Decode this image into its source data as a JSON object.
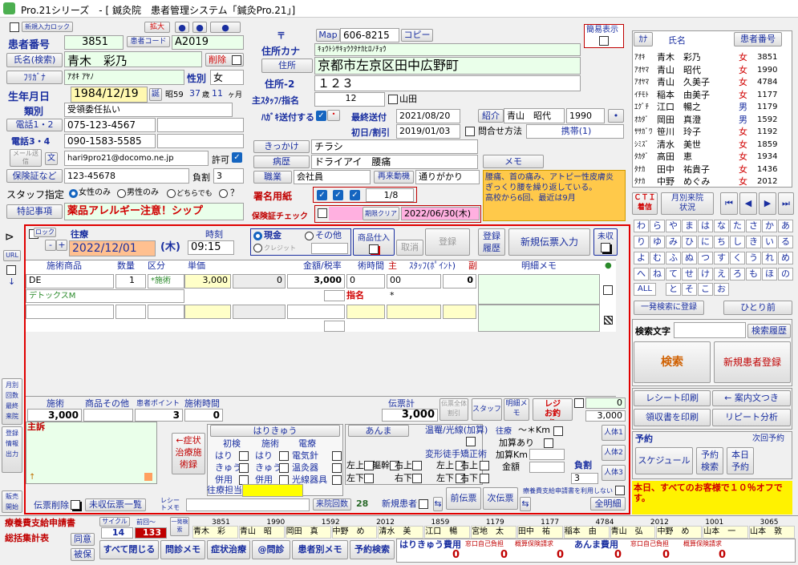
{
  "window": {
    "title": "Pro.21シリーズ　- [ 鍼灸院　患者管理システム「鍼灸Pro.21」]"
  },
  "patient": {
    "input_lock": "新規入力ロック",
    "zoom": "拡大",
    "patient_no_label": "患者番号",
    "patient_no": "3851",
    "patient_code_label": "患者コード",
    "patient_code": "A2019",
    "name_search": "氏名(検索)",
    "name": "青木　彩乃",
    "delete": "削除",
    "furigana_label": "ﾌﾘｶﾞﾅ",
    "furigana": "ｱｵｷ ｱﾔﾉ",
    "sex_label": "性別",
    "sex": "女",
    "birth_label": "生年月日",
    "birth": "1984/12/19",
    "birth_tan": "誕",
    "wareki": "昭59",
    "age": "37",
    "age_unit": "歳",
    "months": "11",
    "month_unit": "ヶ月",
    "category_label": "類別",
    "category": "受領委任払い",
    "tel12": "電話1・2",
    "tel1": "075-123-4567",
    "tel34": "電話3・4",
    "tel3": "090-1583-5585",
    "mail_send": "メール送信",
    "mail_char": "文",
    "email": "hari9pro21@docomo.ne.jp",
    "allow": "許可",
    "insurance_label": "保険証など",
    "insurance": "123-45678",
    "burden_label": "負割",
    "burden": "3",
    "staff_label": "スタッフ指定",
    "staff_opt1": "女性のみ",
    "staff_opt2": "男性のみ",
    "staff_opt3": "どちらでも",
    "staff_q": "？",
    "notes_label": "特記事項",
    "notes": "薬品アレルギー注意！シップ"
  },
  "address": {
    "zip_mark": "〒",
    "map": "Map",
    "zip": "606-8215",
    "copy": "コピー",
    "kana_label": "住所カナ",
    "kana": "ｷｮｳﾄｼｻｷｮｳｸﾀﾅｶﾋﾛﾉﾁｮｳ",
    "addr_btn": "住所",
    "addr": "京都市左京区田中広野町",
    "addr2_label": "住所-2",
    "addr2": "１２３",
    "main_staff_label": "主ｽﾀｯﾌ/指名",
    "main_staff": "12",
    "yamada": "山田",
    "postcard_label": "ﾊｶﾞｷ送付する",
    "last_sent_label": "最終送付",
    "last_sent": "2021/08/20",
    "intro_label": "紹介",
    "intro_name": "青山　昭代",
    "intro_no": "1990",
    "intro_dot": "•",
    "first_visit_label": "初日/割引",
    "first_visit": "2019/01/03",
    "inquiry_label": "問合せ方法",
    "inquiry": "携帯(1)",
    "trigger_btn": "きっかけ",
    "trigger": "チラシ",
    "disease_btn": "病歴",
    "disease": "ドライアイ　腰痛",
    "memo_btn": "メモ",
    "job_btn": "職業",
    "job": "会社員",
    "revisit_btn": "再来動機",
    "revisit": "通りがかり",
    "memo_text": "腰痛、首の痛み、アトピー性皮膚炎\nぎっくり腰を繰り返している。\n高校から6回、最近は9月",
    "sign_label": "署名用紙",
    "sign_count": "1/8",
    "ins_check_label": "保険証チェック",
    "expiry_label": "期限クリア",
    "expiry": "2022/06/30(木)",
    "simple_view": "簡易表示"
  },
  "patient_list": {
    "col_kana": "ｶﾅ",
    "col_name": "氏名",
    "col_no": "患者番号",
    "rows": [
      {
        "kana": "ｱｵｷ",
        "name": "青木　彩乃",
        "sex": "女",
        "no": "3851"
      },
      {
        "kana": "ｱｵﾔﾏ",
        "name": "青山　昭代",
        "sex": "女",
        "no": "1990"
      },
      {
        "kana": "ｱｵﾔﾏ",
        "name": "青山　久美子",
        "sex": "女",
        "no": "4784"
      },
      {
        "kana": "ｲﾁﾓﾄ",
        "name": "稲本　由美子",
        "sex": "女",
        "no": "1177"
      },
      {
        "kana": "ｴｸﾞﾁ",
        "name": "江口　暢之",
        "sex": "男",
        "no": "1179"
      },
      {
        "kana": "ｵｶﾀﾞ",
        "name": "岡田　真澄",
        "sex": "男",
        "no": "1592"
      },
      {
        "kana": "ｻｻｶﾞﾜ",
        "name": "笹川　玲子",
        "sex": "女",
        "no": "1192"
      },
      {
        "kana": "ｼﾐｽﾞ",
        "name": "清水　美世",
        "sex": "女",
        "no": "1859"
      },
      {
        "kana": "ﾀｶﾀﾞ",
        "name": "高田　恵",
        "sex": "女",
        "no": "1934"
      },
      {
        "kana": "ﾀﾅｶ",
        "name": "田中　祐貴子",
        "sex": "女",
        "no": "1436"
      },
      {
        "kana": "ﾀﾅｶ",
        "name": "中野　めぐみ",
        "sex": "女",
        "no": "2012"
      }
    ],
    "cti": "ＣＴＩ着信",
    "monthly": "月別来院状況",
    "kana_keys": [
      "わ",
      "ら",
      "や",
      "ま",
      "は",
      "な",
      "た",
      "さ",
      "か",
      "あ",
      "り",
      "ゆ",
      "み",
      "ひ",
      "に",
      "ち",
      "し",
      "き",
      "い",
      "る",
      "よ",
      "む",
      "ふ",
      "ぬ",
      "つ",
      "す",
      "く",
      "う",
      "れ",
      "め",
      "へ",
      "ね",
      "て",
      "せ",
      "け",
      "え",
      "ろ",
      "も",
      "ほ",
      "の",
      "と",
      "そ",
      "こ",
      "お"
    ],
    "all_key": "ALL",
    "one_search": "一発検索に登録",
    "hitori": "ひとり前",
    "search_label": "検索文字",
    "search_history": "検索履歴",
    "search": "検索",
    "new_patient": "新規患者登録",
    "receipt_print": "レシート印刷",
    "guide": "← 案内文つき",
    "receipt_issue": "領収書を印刷",
    "repeat": "リピート分析",
    "reserve_label": "予約",
    "next_reserve": "次回予約",
    "schedule": "スケジュール",
    "reserve_search": "予約検索",
    "today_reserve": "本日予約",
    "notice": "本日、すべてのお客様で１０％オフです。"
  },
  "slip": {
    "lock": "ロック",
    "visit_label": "往療",
    "visit_date": "2022/12/01",
    "weekday": "(木)",
    "time_label": "時刻",
    "time": "09:15",
    "cash": "現金",
    "other": "その他",
    "credit": "クレジット",
    "stock": "商品仕入",
    "cancel": "取消",
    "register": "登録",
    "reg_history": "登録履歴",
    "new_slip": "新規伝票入力",
    "unpaid": "未収",
    "headers": [
      "施術商品",
      "数量",
      "区分",
      "単価",
      "金額/税率",
      "術時間",
      "主",
      "ｽﾀｯﾌ(ﾎﾟｲﾝﾄ)",
      "副",
      "明細メモ"
    ],
    "row1": {
      "item": "DE",
      "qty": "1",
      "kind": "*施術",
      "price": "3,000",
      "tax": "0",
      "amount": "3,000",
      "time": "0",
      "staff": "00",
      "sub": "0"
    },
    "row1b": {
      "item": "デトックスM",
      "shimei": "指名",
      "star": "*"
    },
    "sum_labels": {
      "treat": "施術",
      "goods": "商品その他",
      "points": "患者ポイント",
      "treat_time": "施術時間",
      "total": "伝票計",
      "discount": "伝票全体割引",
      "staff": "スタッフ",
      "detail_memo": "明細メモ",
      "register_change": "レジお釣り"
    },
    "sum_values": {
      "treat": "3,000",
      "goods": "",
      "points": "3",
      "treat_time": "0",
      "total": "3,000",
      "cash_in": "0",
      "change": "3,000"
    },
    "chief": "主訴",
    "side": [
      "月別",
      "回数",
      "最終",
      "来院",
      "登録",
      "情報",
      "出力",
      "販売",
      "開始"
    ],
    "url": "URL",
    "symptom": "←症状治療施術録",
    "hari_title": "はりきゅう",
    "anma_title": "あんま",
    "heat_title": "温罨/光線(加算)",
    "col_first": "初検",
    "col_treat": "施術",
    "col_elec": "電療",
    "rows_first": [
      "はり",
      "きゅう",
      "併用"
    ],
    "rows_treat": [
      "はり",
      "きゅう",
      "併用"
    ],
    "rows_elec": [
      "電気針",
      "温灸器",
      "光線器具"
    ],
    "deform": "変形徒手矯正術",
    "anma_pos": [
      "左上",
      "軀幹",
      "右上",
      "左下",
      "右下"
    ],
    "deform_pos": [
      "左上",
      "右上",
      "左下",
      "右下"
    ],
    "visit_km": "〜＊Km",
    "visit_add": "加算あり",
    "visit_addkm": "加算Km",
    "visit_amount": "金額",
    "burden": "負割",
    "burden_val": "3",
    "persons": [
      "人体1",
      "人体2",
      "人体3"
    ],
    "staff_label": "往療担当",
    "receipt_memo": "レシートメモ",
    "visit_count": "来院回数",
    "visit_count_val": "28",
    "new_patient": "新規患者",
    "prev_slip": "前伝票",
    "next_slip": "次伝票",
    "self_pay": "療養費支給申請書を利用しない",
    "all_detail": "全明細",
    "slip_delete": "伝票削除",
    "unpaid_list": "未収伝票一覧"
  },
  "bottom": {
    "apply": "療養費支給申請書",
    "summary": "総括集計表",
    "cycle": "サイクル",
    "prev": "前回〜",
    "cycle_val": "14",
    "prev_val": "133",
    "one_check": "一発検索",
    "agree": "同意",
    "insured": "被保",
    "history_nos": [
      "3851",
      "1990",
      "1592",
      "2012",
      "1859",
      "1179",
      "1177",
      "4784",
      "2012",
      "1001",
      "3065"
    ],
    "history_names": [
      "青木　彩",
      "青山　昭",
      "岡田　真",
      "中野　め",
      "清水　美",
      "江口　暢",
      "宮地　太",
      "田中　祐",
      "稲本　由",
      "青山　弘",
      "中野　め",
      "山本　一",
      "山本　敦"
    ],
    "close_all": "すべて閉じる",
    "diag_memo": "問診メモ",
    "symptom_treat": "症状治療",
    "atdiag": "@問診",
    "patient_memo": "患者別メモ",
    "reserve_search": "予約検索",
    "hari_cost": "はりきゅう費用",
    "self_pay": "窓口自己負担",
    "ins_claim": "概算保険請求",
    "anma_cost": "あんま費用",
    "hari_val": "0",
    "self_val": "0",
    "claim_val": "0",
    "anma_val": "0",
    "self2_val": "0",
    "claim2_val": "0"
  }
}
